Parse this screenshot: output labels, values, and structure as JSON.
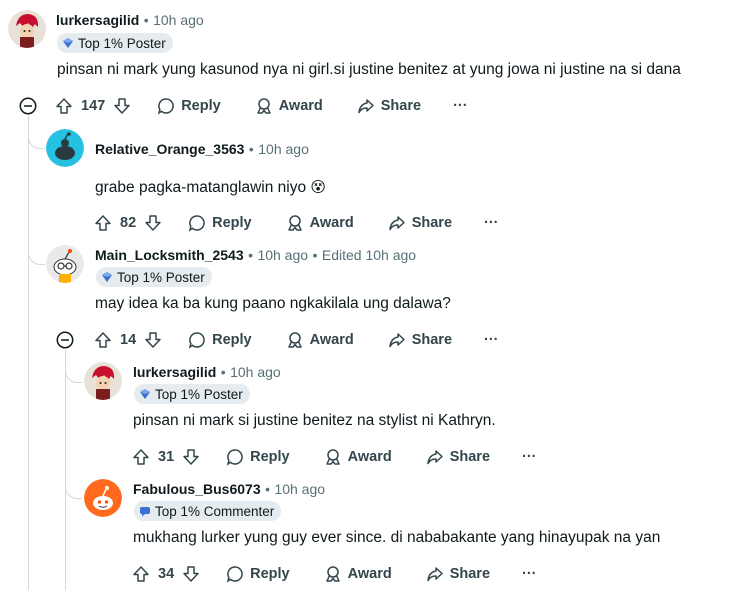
{
  "comments": [
    {
      "username": "lurkersagilid",
      "time": "10h ago",
      "flair": "Top 1% Poster",
      "body": "pinsan ni mark yung kasunod nya ni girl.si justine benitez at yung jowa ni justine na si dana",
      "votes": "147",
      "avatar": "red-hair-avatar-icon"
    },
    {
      "username": "Relative_Orange_3563",
      "time": "10h ago",
      "body": "grabe pagka-matanglawin niyo",
      "emoji": "😵",
      "votes": "82",
      "avatar": "default-snoo-cyan-avatar-icon"
    },
    {
      "username": "Main_Locksmith_2543",
      "time": "10h ago",
      "edited": "Edited 10h ago",
      "flair": "Top 1% Poster",
      "body": "may idea ka ba kung paano ngkakilala ung dalawa?",
      "votes": "14",
      "avatar": "snoo-glasses-avatar-icon"
    },
    {
      "username": "lurkersagilid",
      "time": "10h ago",
      "flair": "Top 1% Poster",
      "body": "pinsan ni mark si justine benitez na stylist ni Kathryn.",
      "votes": "31",
      "avatar": "red-hair-avatar-icon"
    },
    {
      "username": "Fabulous_Bus6073",
      "time": "10h ago",
      "flair": "Top 1% Commenter",
      "body": "mukhang lurker yung guy ever since. di nababakante yang hinayupak na yan",
      "votes": "34",
      "avatar": "default-snoo-orange-avatar-icon"
    }
  ],
  "actions": {
    "reply": "Reply",
    "award": "Award",
    "share": "Share",
    "more": "···"
  },
  "separator": "•",
  "colors": {
    "text": "#0f1a1c",
    "meta": "#576f76",
    "flair_bg": "#e5ebee",
    "thread_line": "#d0d8db",
    "orange_avatar": "#ff6a1f",
    "cyan_avatar": "#24c2e0"
  }
}
